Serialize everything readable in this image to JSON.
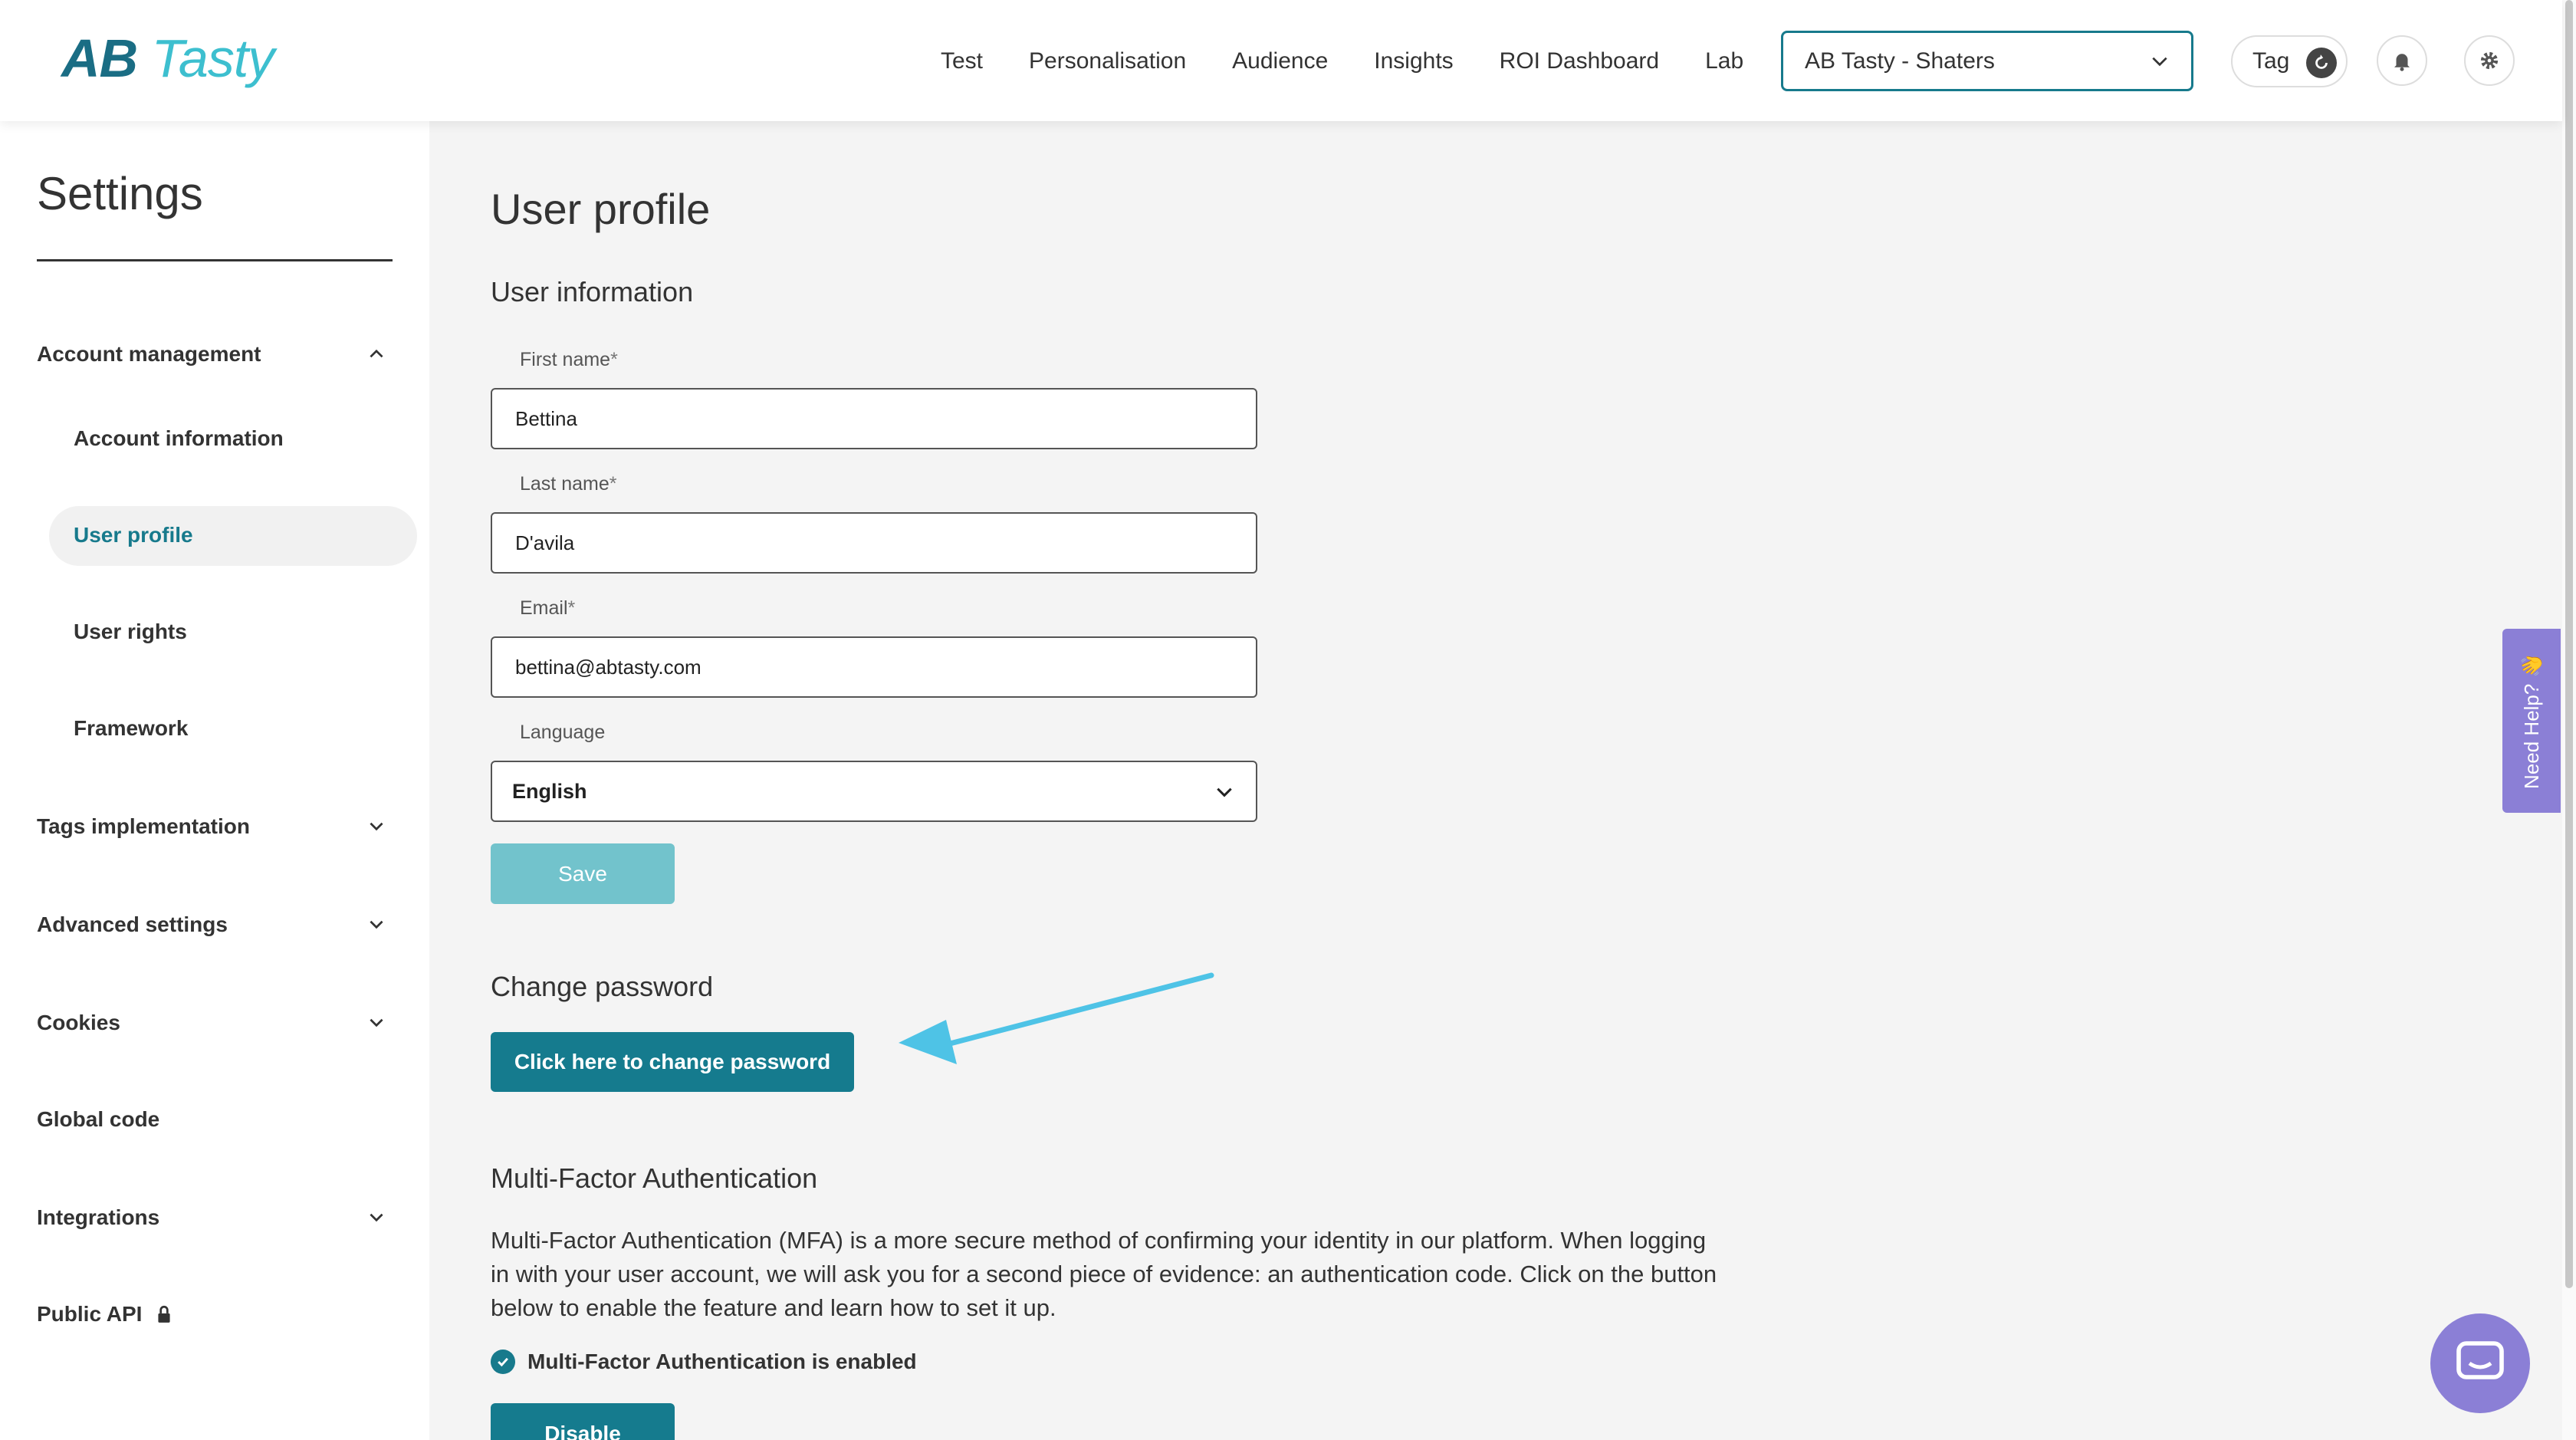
{
  "brand": {
    "logo_ab": "AB",
    "logo_tasty": "Tasty"
  },
  "nav": {
    "items": [
      "Test",
      "Personalisation",
      "Audience",
      "Insights",
      "ROI Dashboard",
      "Lab"
    ],
    "account_selector": "AB Tasty - Shaters",
    "tag_label": "Tag"
  },
  "sidebar": {
    "title": "Settings",
    "sections": [
      {
        "label": "Account management",
        "expanded": true
      },
      {
        "label": "Tags implementation",
        "expanded": false
      },
      {
        "label": "Advanced settings",
        "expanded": false
      },
      {
        "label": "Cookies",
        "expanded": false
      },
      {
        "label": "Global code"
      },
      {
        "label": "Integrations",
        "expanded": false
      },
      {
        "label": "Public API",
        "locked": true
      }
    ],
    "subitems": [
      "Account information",
      "User profile",
      "User rights",
      "Framework"
    ],
    "active": "User profile"
  },
  "main": {
    "title": "User profile",
    "user_info_heading": "User information",
    "first_name": {
      "label": "First name",
      "value": "Bettina"
    },
    "last_name": {
      "label": "Last name",
      "value": "D'avila"
    },
    "email": {
      "label": "Email",
      "value": "bettina@abtasty.com"
    },
    "language": {
      "label": "Language",
      "value": "English"
    },
    "required_mark": "*",
    "save_label": "Save",
    "change_password_heading": "Change password",
    "change_password_button": "Click here to change password",
    "mfa_heading": "Multi-Factor Authentication",
    "mfa_description": "Multi-Factor Authentication (MFA) is a more secure method of confirming your identity in our platform. When logging in with your user account, we will ask you for a second piece of evidence: an authentication code. Click on the button below to enable the feature and learn how to set it up.",
    "mfa_status": "Multi-Factor Authentication is enabled",
    "disable_label": "Disable"
  },
  "help": {
    "tab_label": "Need Help? 👋"
  },
  "colors": {
    "accent": "#177a8c",
    "save_disabled": "#72c3cc",
    "annotation_arrow": "#4ec3e6",
    "help": "#8b7fd6"
  }
}
